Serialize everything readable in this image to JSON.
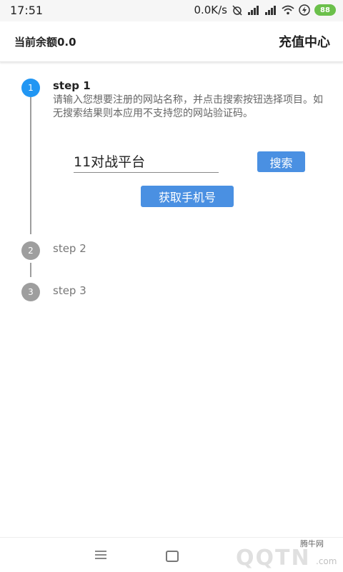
{
  "statusbar": {
    "time": "17:51",
    "speed": "0.0K/s",
    "battery": "88",
    "icons": [
      "alarm-off-icon",
      "signal-icon",
      "signal-icon",
      "wifi-icon",
      "charging-icon"
    ]
  },
  "header": {
    "balance": "当前余额0.0",
    "recharge": "充值中心"
  },
  "steps": [
    {
      "num": "1",
      "title": "step 1",
      "description": "请输入您想要注册的网站名称，并点击搜索按钮选择项目。如无搜索结果则本应用不支持您的网站验证码。"
    },
    {
      "num": "2",
      "title": "step 2"
    },
    {
      "num": "3",
      "title": "step 3"
    }
  ],
  "form": {
    "query_value": "11对战平台",
    "search_label": "搜索",
    "get_phone_label": "获取手机号"
  },
  "watermark": {
    "cn": "腾牛网",
    "en": "QQTN",
    "com": ".com"
  },
  "colors": {
    "accent": "#2196f3",
    "button": "#4a90e2",
    "inactive": "#9e9e9e",
    "battery": "#6bc04b"
  }
}
